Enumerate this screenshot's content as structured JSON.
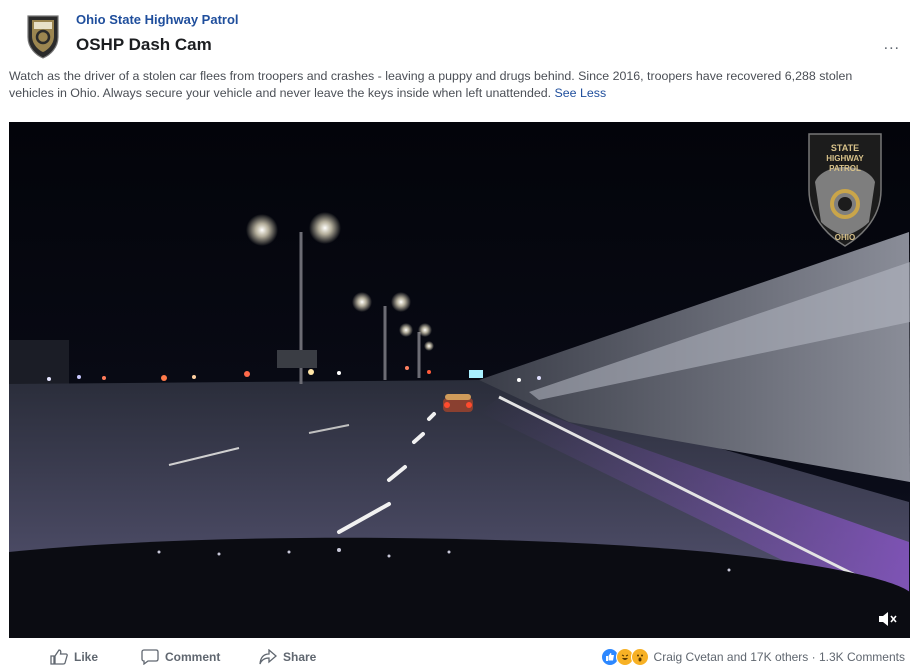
{
  "post": {
    "page_name": "Ohio State Highway Patrol",
    "title": "OSHP Dash Cam",
    "more_label": "...",
    "caption": "Watch as the driver of a stolen car flees from troopers and crashes - leaving a puppy and drugs behind. Since 2016, troopers have recovered 6,288 stolen vehicles in Ohio. Always secure your vehicle and never leave the keys inside when left unattended.",
    "see_less": "See Less"
  },
  "video": {
    "watermark": {
      "line1": "STATE",
      "line2": "HIGHWAY",
      "line3": "PATROL",
      "line4": "OHIO"
    },
    "muted": true
  },
  "actions": {
    "like": "Like",
    "comment": "Comment",
    "share": "Share"
  },
  "reactions": {
    "icons": [
      "like-icon",
      "haha-icon",
      "wow-icon"
    ],
    "colors": {
      "like": "#2d88ff",
      "haha": "#f7b125",
      "wow": "#f7b125"
    },
    "summary": "Craig Cvetan and 17K others · 1.3K Comments"
  },
  "colors": {
    "brand_link": "#1f4e9c",
    "text": "#4b4f56",
    "muted": "#606770"
  }
}
